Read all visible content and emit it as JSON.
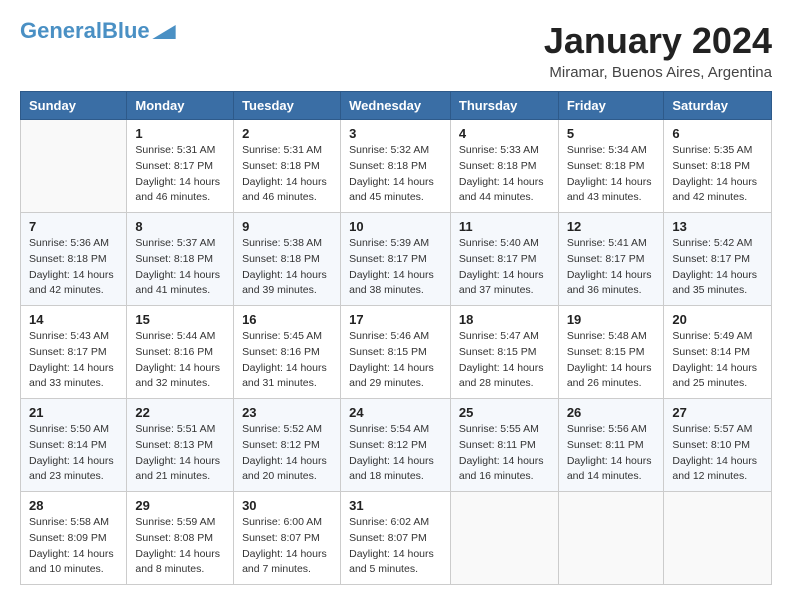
{
  "header": {
    "logo_general": "General",
    "logo_blue": "Blue",
    "title": "January 2024",
    "subtitle": "Miramar, Buenos Aires, Argentina"
  },
  "days_of_week": [
    "Sunday",
    "Monday",
    "Tuesday",
    "Wednesday",
    "Thursday",
    "Friday",
    "Saturday"
  ],
  "weeks": [
    [
      {
        "day": "",
        "info": ""
      },
      {
        "day": "1",
        "info": "Sunrise: 5:31 AM\nSunset: 8:17 PM\nDaylight: 14 hours\nand 46 minutes."
      },
      {
        "day": "2",
        "info": "Sunrise: 5:31 AM\nSunset: 8:18 PM\nDaylight: 14 hours\nand 46 minutes."
      },
      {
        "day": "3",
        "info": "Sunrise: 5:32 AM\nSunset: 8:18 PM\nDaylight: 14 hours\nand 45 minutes."
      },
      {
        "day": "4",
        "info": "Sunrise: 5:33 AM\nSunset: 8:18 PM\nDaylight: 14 hours\nand 44 minutes."
      },
      {
        "day": "5",
        "info": "Sunrise: 5:34 AM\nSunset: 8:18 PM\nDaylight: 14 hours\nand 43 minutes."
      },
      {
        "day": "6",
        "info": "Sunrise: 5:35 AM\nSunset: 8:18 PM\nDaylight: 14 hours\nand 42 minutes."
      }
    ],
    [
      {
        "day": "7",
        "info": "Sunrise: 5:36 AM\nSunset: 8:18 PM\nDaylight: 14 hours\nand 42 minutes."
      },
      {
        "day": "8",
        "info": "Sunrise: 5:37 AM\nSunset: 8:18 PM\nDaylight: 14 hours\nand 41 minutes."
      },
      {
        "day": "9",
        "info": "Sunrise: 5:38 AM\nSunset: 8:18 PM\nDaylight: 14 hours\nand 39 minutes."
      },
      {
        "day": "10",
        "info": "Sunrise: 5:39 AM\nSunset: 8:17 PM\nDaylight: 14 hours\nand 38 minutes."
      },
      {
        "day": "11",
        "info": "Sunrise: 5:40 AM\nSunset: 8:17 PM\nDaylight: 14 hours\nand 37 minutes."
      },
      {
        "day": "12",
        "info": "Sunrise: 5:41 AM\nSunset: 8:17 PM\nDaylight: 14 hours\nand 36 minutes."
      },
      {
        "day": "13",
        "info": "Sunrise: 5:42 AM\nSunset: 8:17 PM\nDaylight: 14 hours\nand 35 minutes."
      }
    ],
    [
      {
        "day": "14",
        "info": "Sunrise: 5:43 AM\nSunset: 8:17 PM\nDaylight: 14 hours\nand 33 minutes."
      },
      {
        "day": "15",
        "info": "Sunrise: 5:44 AM\nSunset: 8:16 PM\nDaylight: 14 hours\nand 32 minutes."
      },
      {
        "day": "16",
        "info": "Sunrise: 5:45 AM\nSunset: 8:16 PM\nDaylight: 14 hours\nand 31 minutes."
      },
      {
        "day": "17",
        "info": "Sunrise: 5:46 AM\nSunset: 8:15 PM\nDaylight: 14 hours\nand 29 minutes."
      },
      {
        "day": "18",
        "info": "Sunrise: 5:47 AM\nSunset: 8:15 PM\nDaylight: 14 hours\nand 28 minutes."
      },
      {
        "day": "19",
        "info": "Sunrise: 5:48 AM\nSunset: 8:15 PM\nDaylight: 14 hours\nand 26 minutes."
      },
      {
        "day": "20",
        "info": "Sunrise: 5:49 AM\nSunset: 8:14 PM\nDaylight: 14 hours\nand 25 minutes."
      }
    ],
    [
      {
        "day": "21",
        "info": "Sunrise: 5:50 AM\nSunset: 8:14 PM\nDaylight: 14 hours\nand 23 minutes."
      },
      {
        "day": "22",
        "info": "Sunrise: 5:51 AM\nSunset: 8:13 PM\nDaylight: 14 hours\nand 21 minutes."
      },
      {
        "day": "23",
        "info": "Sunrise: 5:52 AM\nSunset: 8:12 PM\nDaylight: 14 hours\nand 20 minutes."
      },
      {
        "day": "24",
        "info": "Sunrise: 5:54 AM\nSunset: 8:12 PM\nDaylight: 14 hours\nand 18 minutes."
      },
      {
        "day": "25",
        "info": "Sunrise: 5:55 AM\nSunset: 8:11 PM\nDaylight: 14 hours\nand 16 minutes."
      },
      {
        "day": "26",
        "info": "Sunrise: 5:56 AM\nSunset: 8:11 PM\nDaylight: 14 hours\nand 14 minutes."
      },
      {
        "day": "27",
        "info": "Sunrise: 5:57 AM\nSunset: 8:10 PM\nDaylight: 14 hours\nand 12 minutes."
      }
    ],
    [
      {
        "day": "28",
        "info": "Sunrise: 5:58 AM\nSunset: 8:09 PM\nDaylight: 14 hours\nand 10 minutes."
      },
      {
        "day": "29",
        "info": "Sunrise: 5:59 AM\nSunset: 8:08 PM\nDaylight: 14 hours\nand 8 minutes."
      },
      {
        "day": "30",
        "info": "Sunrise: 6:00 AM\nSunset: 8:07 PM\nDaylight: 14 hours\nand 7 minutes."
      },
      {
        "day": "31",
        "info": "Sunrise: 6:02 AM\nSunset: 8:07 PM\nDaylight: 14 hours\nand 5 minutes."
      },
      {
        "day": "",
        "info": ""
      },
      {
        "day": "",
        "info": ""
      },
      {
        "day": "",
        "info": ""
      }
    ]
  ]
}
